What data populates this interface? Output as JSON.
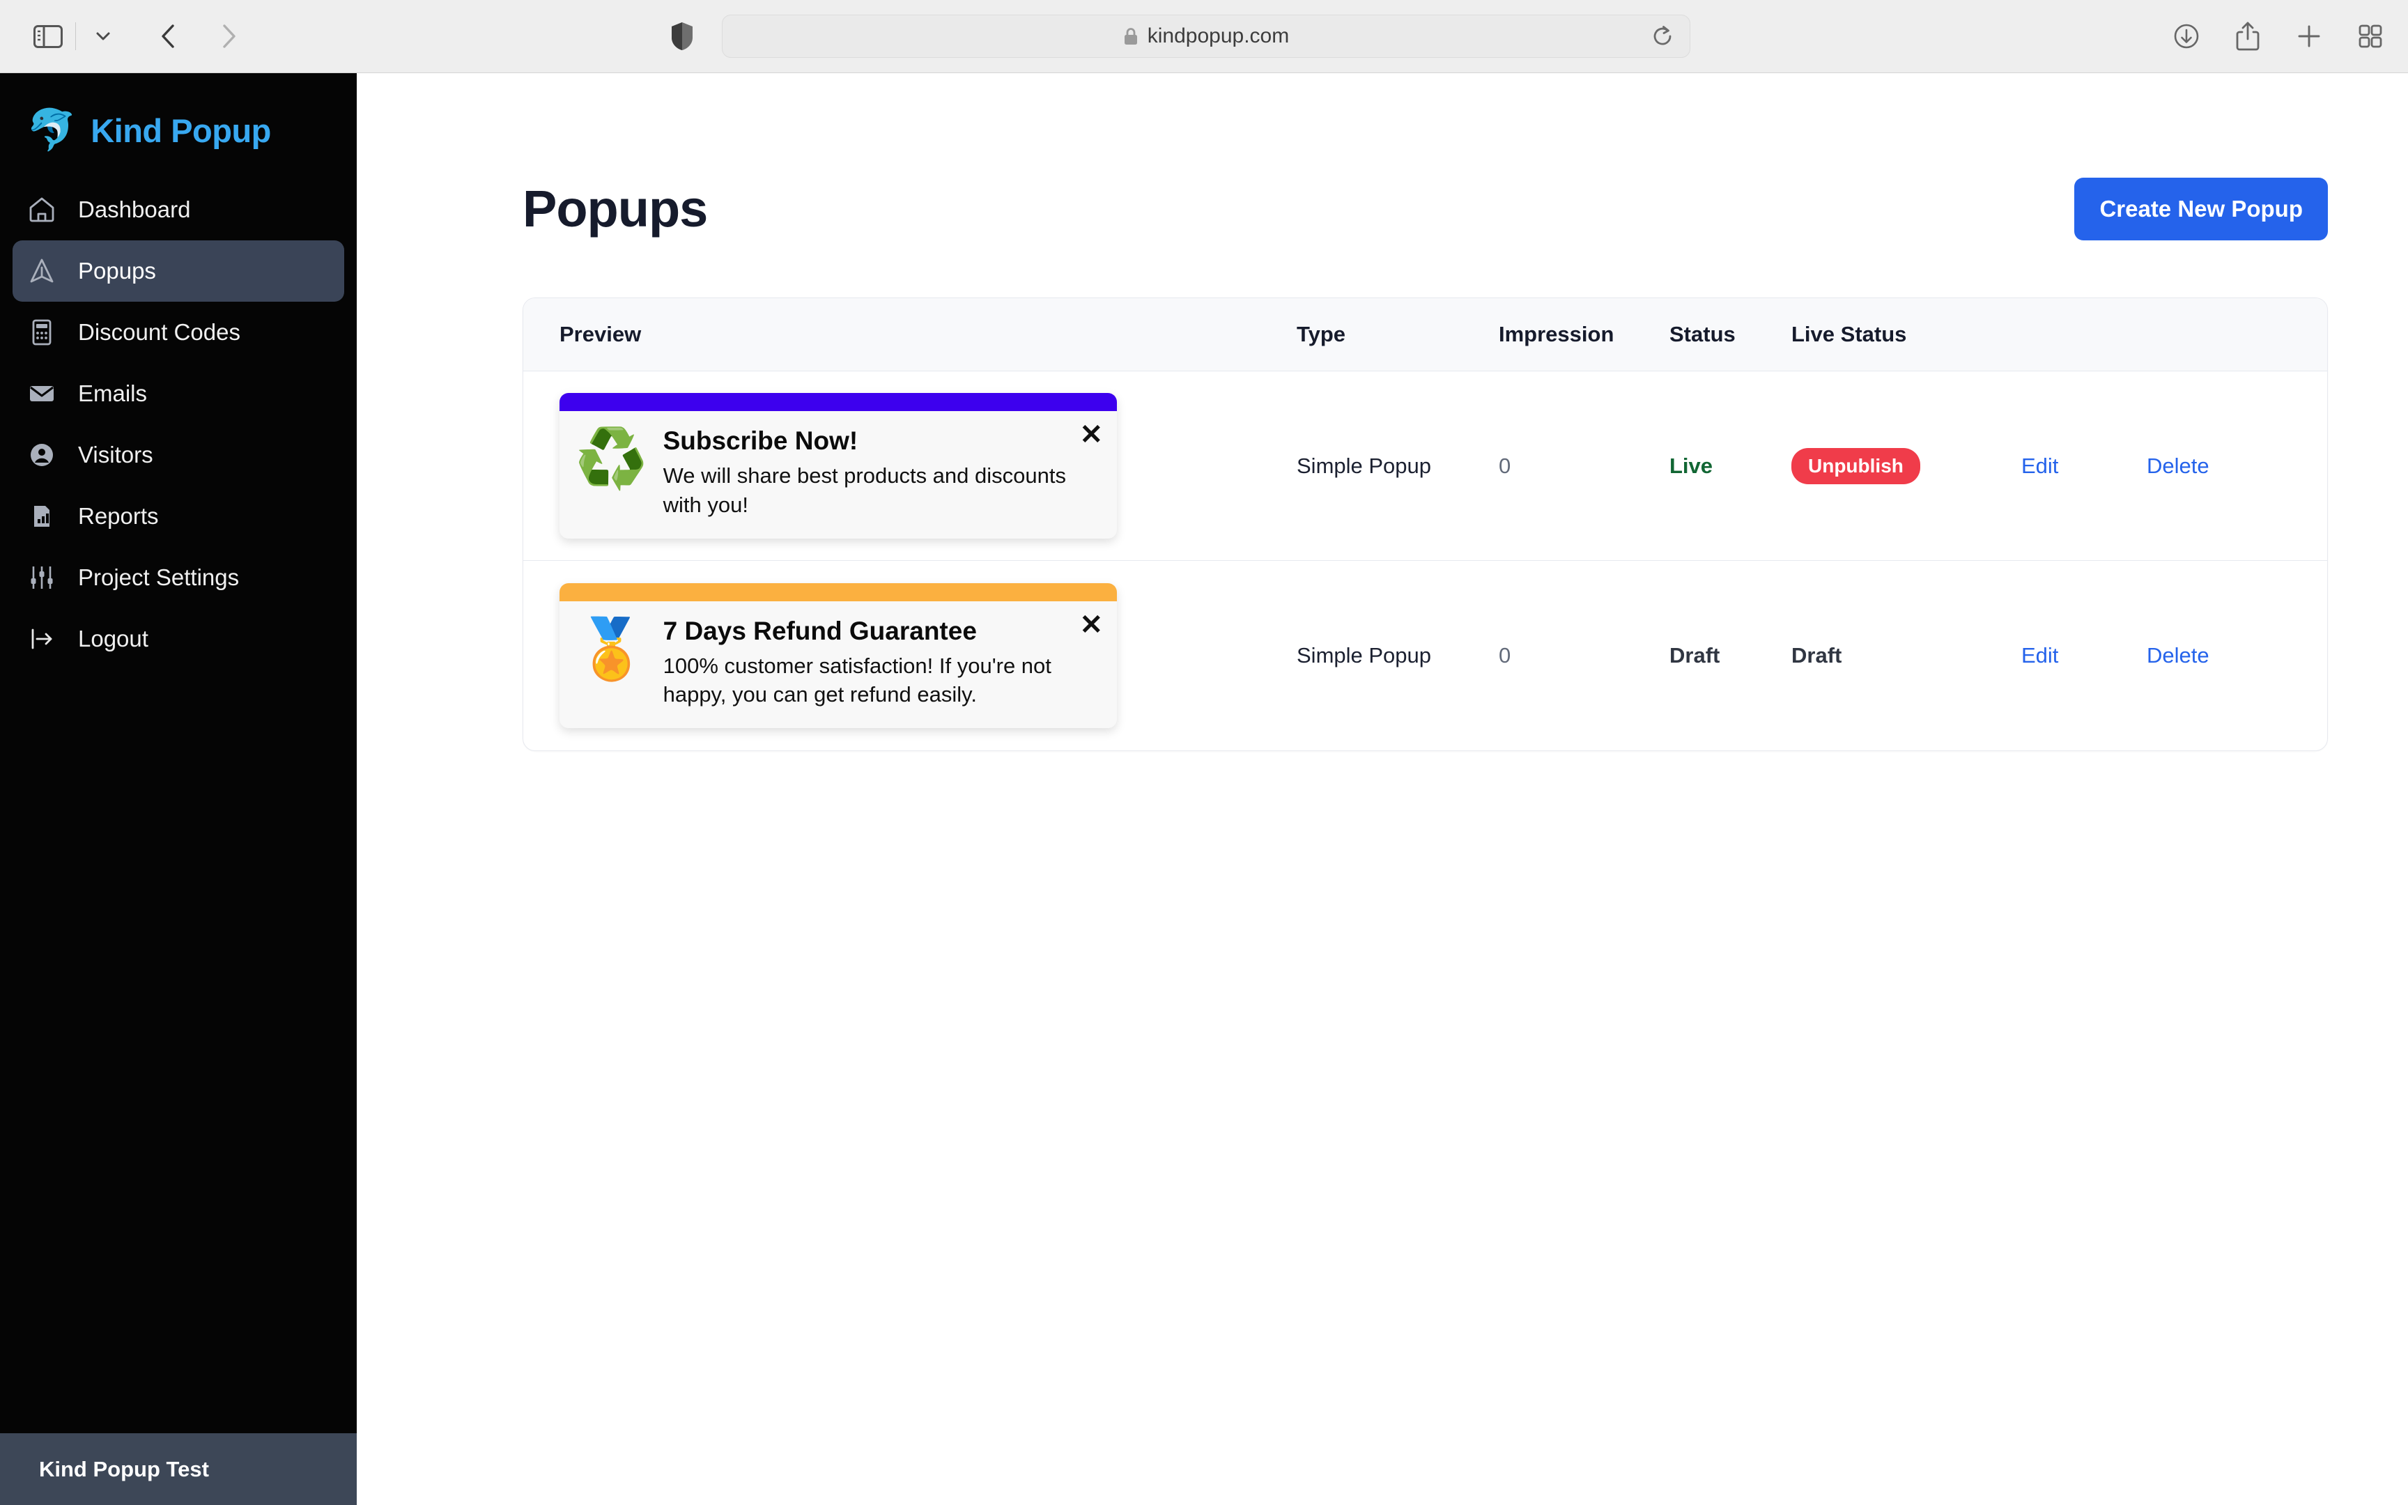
{
  "browser": {
    "url": "kindpopup.com",
    "icons": {
      "sidebar_toggle": "sidebar-toggle-icon",
      "tab_group_caret": "chevron-down-icon",
      "back": "back-arrow-icon",
      "forward": "forward-arrow-icon",
      "shield": "privacy-shield-icon",
      "lock": "lock-icon",
      "reload": "reload-icon",
      "downloads": "downloads-icon",
      "share": "share-icon",
      "new_tab": "plus-icon",
      "tab_overview": "tab-overview-icon"
    }
  },
  "sidebar": {
    "brand": {
      "logo": "🐬",
      "name": "Kind Popup"
    },
    "items": [
      {
        "label": "Dashboard",
        "icon": "home-icon",
        "active": false
      },
      {
        "label": "Popups",
        "icon": "popup-send-icon",
        "active": true
      },
      {
        "label": "Discount Codes",
        "icon": "calculator-icon",
        "active": false
      },
      {
        "label": "Emails",
        "icon": "envelope-icon",
        "active": false
      },
      {
        "label": "Visitors",
        "icon": "user-circle-icon",
        "active": false
      },
      {
        "label": "Reports",
        "icon": "bar-chart-icon",
        "active": false
      },
      {
        "label": "Project Settings",
        "icon": "sliders-icon",
        "active": false
      },
      {
        "label": "Logout",
        "icon": "logout-icon",
        "active": false
      }
    ],
    "footer": {
      "project_name": "Kind Popup Test"
    }
  },
  "page": {
    "title": "Popups",
    "create_button": "Create New Popup"
  },
  "table": {
    "headers": {
      "preview": "Preview",
      "type": "Type",
      "impression": "Impression",
      "status": "Status",
      "live_status": "Live Status"
    },
    "rows": [
      {
        "preview": {
          "bar_color": "#3d00ee",
          "emoji": "♻️",
          "title": "Subscribe Now!",
          "description": "We will share best products and discounts with you!",
          "close": "✕"
        },
        "type": "Simple Popup",
        "impression": "0",
        "status": "Live",
        "live_status": "Unpublish",
        "live_status_kind": "badge",
        "edit": "Edit",
        "delete": "Delete"
      },
      {
        "preview": {
          "bar_color": "#fbb040",
          "emoji": "🏅",
          "title": "7 Days Refund Guarantee",
          "description": "100% customer satisfaction! If you're not happy, you can get refund easily.",
          "close": "✕"
        },
        "type": "Simple Popup",
        "impression": "0",
        "status": "Draft",
        "live_status": "Draft",
        "live_status_kind": "text",
        "edit": "Edit",
        "delete": "Delete"
      }
    ]
  },
  "colors": {
    "brand_blue": "#38a8f0",
    "accent_blue": "#2563eb",
    "danger_red": "#f03c4a",
    "live_green": "#116633",
    "sidebar_bg": "#050505",
    "sidebar_active": "#3a4457",
    "footer_bg": "#3d4757"
  }
}
